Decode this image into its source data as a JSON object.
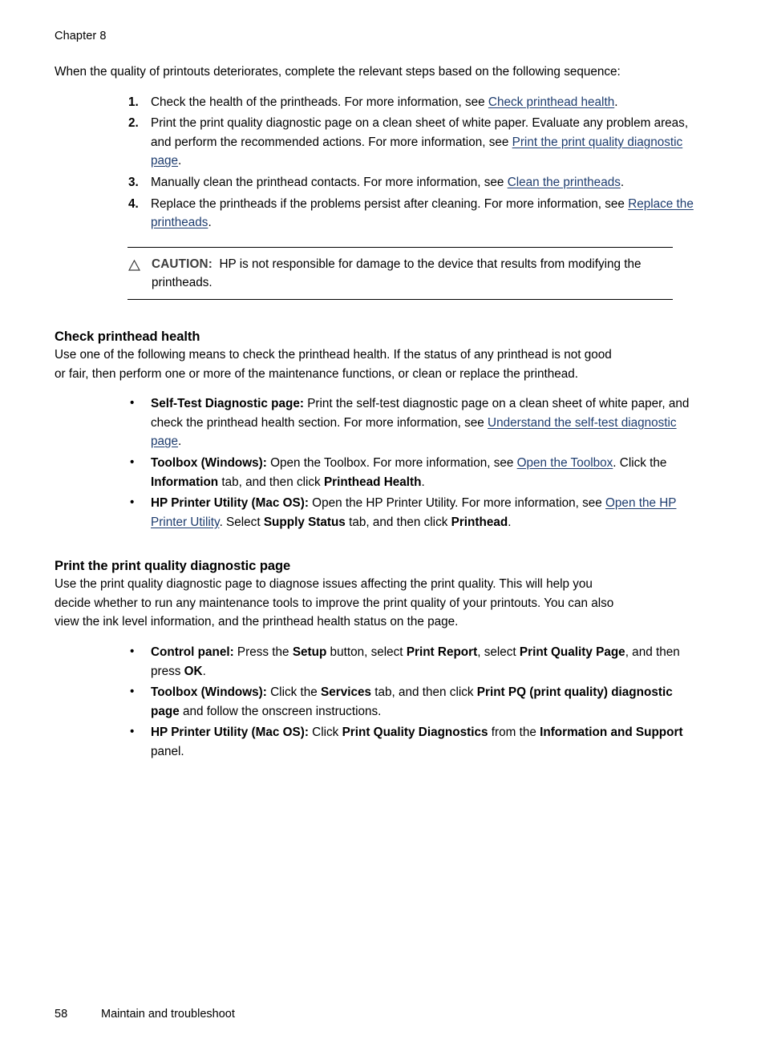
{
  "page": {
    "running_header": "Chapter 8",
    "footer_page_number": "58",
    "footer_title": "Maintain and troubleshoot",
    "link_color": "#1d3c6e",
    "caution_label_color": "#3b3b3b",
    "bullet_glyph": "•"
  },
  "intro": {
    "paragraph": "When the quality of printouts deteriorates, complete the relevant steps based on the following sequence:"
  },
  "steps": [
    {
      "number": "1.",
      "parts": [
        {
          "type": "text",
          "text": "Check the health of the printheads. For more information, see "
        },
        {
          "type": "link",
          "text": "Check printhead health"
        },
        {
          "type": "text",
          "text": "."
        }
      ]
    },
    {
      "number": "2.",
      "parts": [
        {
          "type": "text",
          "text": "Print the print quality diagnostic page on a clean sheet of white paper. Evaluate any problem areas, and perform the recommended actions. For more information, see "
        },
        {
          "type": "link",
          "text": "Print the print quality diagnostic page"
        },
        {
          "type": "text",
          "text": "."
        }
      ]
    },
    {
      "number": "3.",
      "parts": [
        {
          "type": "text",
          "text": "Manually clean the printhead contacts. For more information, see "
        },
        {
          "type": "link",
          "text": "Clean the printheads"
        },
        {
          "type": "text",
          "text": "."
        }
      ]
    },
    {
      "number": "4.",
      "parts": [
        {
          "type": "text",
          "text": "Replace the printheads if the problems persist after cleaning. For more information, see "
        },
        {
          "type": "link",
          "text": "Replace the printheads"
        },
        {
          "type": "text",
          "text": "."
        }
      ]
    }
  ],
  "caution": {
    "icon": "warning-triangle-icon",
    "label": "CAUTION:",
    "text": "HP is not responsible for damage to the device that results from modifying the printheads."
  },
  "section_check": {
    "heading": "Check printhead health",
    "paragraph": "Use one of the following means to check the printhead health. If the status of any printhead is not good or fair, then perform one or more of the maintenance functions, or clean or replace the printhead.",
    "bullets": [
      {
        "parts": [
          {
            "type": "bold",
            "text": "Self-Test Diagnostic page:"
          },
          {
            "type": "text",
            "text": " Print the self-test diagnostic page on a clean sheet of white paper, and check the printhead health section. For more information, see "
          },
          {
            "type": "link",
            "text": "Understand the self-test diagnostic page"
          },
          {
            "type": "text",
            "text": "."
          }
        ]
      },
      {
        "parts": [
          {
            "type": "bold",
            "text": "Toolbox (Windows):"
          },
          {
            "type": "text",
            "text": " Open the Toolbox. For more information, see "
          },
          {
            "type": "link",
            "text": "Open the Toolbox"
          },
          {
            "type": "text",
            "text": ". Click the "
          },
          {
            "type": "bold",
            "text": "Information"
          },
          {
            "type": "text",
            "text": " tab, and then click "
          },
          {
            "type": "bold",
            "text": "Printhead Health"
          },
          {
            "type": "text",
            "text": "."
          }
        ]
      },
      {
        "parts": [
          {
            "type": "bold",
            "text": "HP Printer Utility (Mac OS):"
          },
          {
            "type": "text",
            "text": " Open the HP Printer Utility. For more information, see "
          },
          {
            "type": "link",
            "text": "Open the HP Printer Utility"
          },
          {
            "type": "text",
            "text": ". Select "
          },
          {
            "type": "bold",
            "text": "Supply Status"
          },
          {
            "type": "text",
            "text": " tab, and then click "
          },
          {
            "type": "bold",
            "text": "Printhead"
          },
          {
            "type": "text",
            "text": "."
          }
        ]
      }
    ]
  },
  "section_print": {
    "heading": "Print the print quality diagnostic page",
    "paragraph": "Use the print quality diagnostic page to diagnose issues affecting the print quality. This will help you decide whether to run any maintenance tools to improve the print quality of your printouts. You can also view the ink level information, and the printhead health status on the page.",
    "bullets": [
      {
        "parts": [
          {
            "type": "bold",
            "text": "Control panel:"
          },
          {
            "type": "text",
            "text": " Press the "
          },
          {
            "type": "bold",
            "text": "Setup"
          },
          {
            "type": "text",
            "text": " button, select "
          },
          {
            "type": "bold",
            "text": "Print Report"
          },
          {
            "type": "text",
            "text": ", select "
          },
          {
            "type": "bold",
            "text": "Print Quality Page"
          },
          {
            "type": "text",
            "text": ", and then press "
          },
          {
            "type": "bold",
            "text": "OK"
          },
          {
            "type": "text",
            "text": "."
          }
        ]
      },
      {
        "parts": [
          {
            "type": "bold",
            "text": "Toolbox (Windows):"
          },
          {
            "type": "text",
            "text": " Click the "
          },
          {
            "type": "bold",
            "text": "Services"
          },
          {
            "type": "text",
            "text": " tab, and then click "
          },
          {
            "type": "bold",
            "text": "Print PQ (print quality) diagnostic page"
          },
          {
            "type": "text",
            "text": " and follow the onscreen instructions."
          }
        ]
      },
      {
        "parts": [
          {
            "type": "bold",
            "text": "HP Printer Utility (Mac OS):"
          },
          {
            "type": "text",
            "text": " Click "
          },
          {
            "type": "bold",
            "text": "Print Quality Diagnostics"
          },
          {
            "type": "text",
            "text": " from the "
          },
          {
            "type": "bold",
            "text": "Information and Support"
          },
          {
            "type": "text",
            "text": " panel."
          }
        ]
      }
    ]
  }
}
